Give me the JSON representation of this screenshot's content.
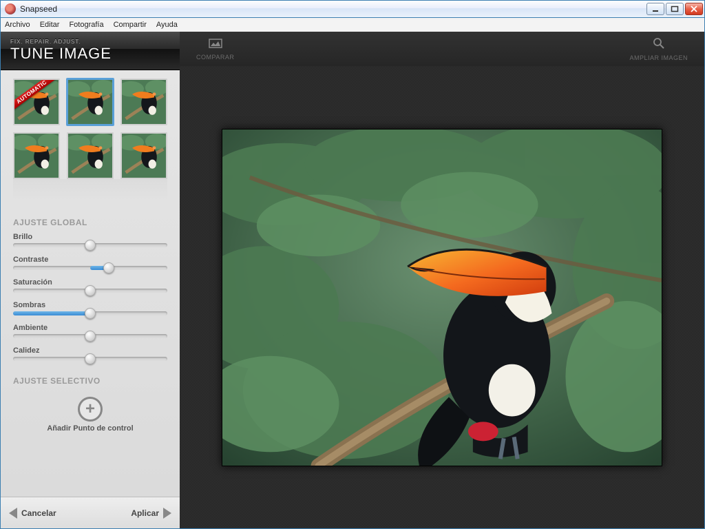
{
  "window": {
    "title": "Snapseed"
  },
  "menu": {
    "items": [
      "Archivo",
      "Editar",
      "Fotografía",
      "Compartir",
      "Ayuda"
    ]
  },
  "tool": {
    "subtitle": "FIX. REPAIR. ADJUST.",
    "title": "TUNE IMAGE"
  },
  "presets": {
    "automatic_ribbon": "AUTOMATIC",
    "items": [
      {
        "id": "auto",
        "selected": false,
        "ribbon": true
      },
      {
        "id": "preset-2",
        "selected": true
      },
      {
        "id": "preset-3",
        "selected": false
      },
      {
        "id": "preset-4",
        "selected": false
      },
      {
        "id": "preset-5",
        "selected": false
      },
      {
        "id": "preset-6",
        "selected": false
      }
    ]
  },
  "sections": {
    "global": "AJUSTE GLOBAL",
    "selective": "AJUSTE SELECTIVO"
  },
  "sliders": [
    {
      "key": "brightness",
      "label": "Brillo",
      "value": 50,
      "fill_from": 50,
      "fill_to": 50
    },
    {
      "key": "contrast",
      "label": "Contraste",
      "value": 62,
      "fill_from": 50,
      "fill_to": 62
    },
    {
      "key": "saturation",
      "label": "Saturación",
      "value": 50,
      "fill_from": 50,
      "fill_to": 50
    },
    {
      "key": "shadows",
      "label": "Sombras",
      "value": 50,
      "fill_from": 0,
      "fill_to": 50
    },
    {
      "key": "ambience",
      "label": "Ambiente",
      "value": 50,
      "fill_from": 50,
      "fill_to": 50
    },
    {
      "key": "warmth",
      "label": "Calidez",
      "value": 50,
      "fill_from": 50,
      "fill_to": 50
    }
  ],
  "add_control_point": {
    "label": "Añadir Punto de control",
    "glyph": "+"
  },
  "bottom": {
    "cancel": "Cancelar",
    "apply": "Aplicar"
  },
  "canvas_actions": {
    "compare": "COMPARAR",
    "zoom": "AMPLIAR IMAGEN"
  },
  "icons": {
    "compare": "image-compare-icon",
    "zoom": "magnifier-icon"
  }
}
